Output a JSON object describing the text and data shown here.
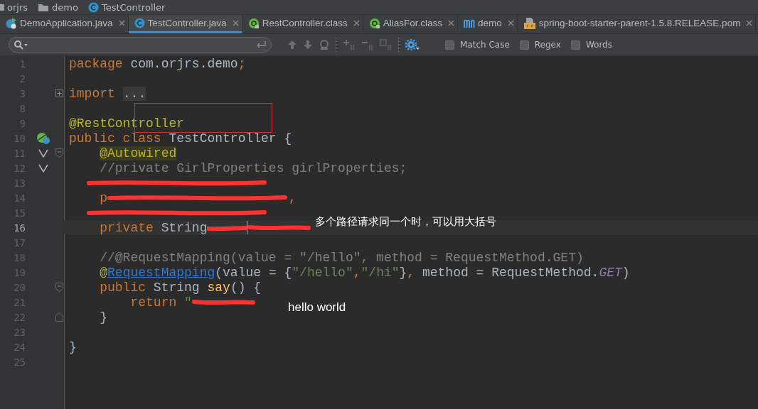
{
  "breadcrumbs": [
    {
      "label": "orjrs",
      "kind": "module"
    },
    {
      "label": "demo",
      "kind": "folder"
    },
    {
      "label": "TestController",
      "kind": "class"
    }
  ],
  "tabs": [
    {
      "label": "DemoApplication.java",
      "kind": "app",
      "selected": false
    },
    {
      "label": "TestController.java",
      "kind": "class",
      "selected": true
    },
    {
      "label": "RestController.class",
      "kind": "annotation",
      "selected": false
    },
    {
      "label": "AliasFor.class",
      "kind": "annotation",
      "selected": false
    },
    {
      "label": "demo",
      "kind": "maven",
      "selected": false
    },
    {
      "label": "spring-boot-starter-parent-1.5.8.RELEASE.pom",
      "kind": "pom",
      "selected": false
    }
  ],
  "search": {
    "options": [
      {
        "label": "Match Case",
        "checked": false
      },
      {
        "label": "Regex",
        "checked": false
      },
      {
        "label": "Words",
        "checked": false
      }
    ]
  },
  "lines": [
    {
      "number": "1",
      "tokens": [
        {
          "kind": "kw",
          "text": "package"
        },
        {
          "kind": "plain",
          "text": " com.orjrs.demo"
        },
        {
          "kind": "kw",
          "text": ";"
        }
      ]
    },
    {
      "number": "2"
    },
    {
      "number": "3",
      "fold": {
        "kind": "collapsed"
      },
      "tokens": [
        {
          "kind": "kw",
          "text": "import"
        },
        {
          "kind": "folded",
          "text": "..."
        }
      ]
    },
    {
      "number": "8"
    },
    {
      "number": "9",
      "tokens": [
        {
          "kind": "ann",
          "text": "@RestController"
        }
      ]
    },
    {
      "number": "10",
      "gutter_icon": {
        "kind": "bean"
      },
      "tokens": [
        {
          "kind": "kw",
          "text": "public class "
        },
        {
          "kind": "plain",
          "text": "TestController {"
        }
      ]
    },
    {
      "number": "11",
      "gutter_icon": {
        "kind": "autowired"
      },
      "fold": {
        "kind": "open"
      },
      "tokens": [
        {
          "kind": "annhl",
          "text": "    @Autowired"
        }
      ]
    },
    {
      "number": "12",
      "gutter_icon": {
        "kind": "autowired"
      },
      "tokens": [
        {
          "kind": "cmt",
          "text": "    //private GirlProperties girlProperties;"
        }
      ]
    },
    {
      "number": "13",
      "tokens": [
        {
          "kind": "longscribble"
        }
      ]
    },
    {
      "number": "14",
      "tokens": [
        {
          "kind": "kw",
          "text": "    p"
        },
        {
          "kind": "longscribble"
        },
        {
          "kind": "kw",
          "text": ","
        }
      ]
    },
    {
      "number": "15",
      "tokens": [
        {
          "kind": "longscribble"
        }
      ]
    },
    {
      "number": "16",
      "current": true,
      "tokens": [
        {
          "kind": "kw",
          "text": "    private "
        },
        {
          "kind": "plain",
          "text": "String"
        },
        {
          "kind": "tinyscribble"
        },
        {
          "kind": "caret"
        },
        {
          "kind": "shortscribble"
        }
      ]
    },
    {
      "number": "17"
    },
    {
      "number": "18",
      "tokens": [
        {
          "kind": "cmt",
          "text": "    //@RequestMapping(value = \"/hello\", method = RequestMethod.GET)"
        }
      ]
    },
    {
      "number": "19",
      "tokens": [
        {
          "kind": "ann",
          "text": "    @"
        },
        {
          "kind": "link",
          "text": "RequestMapping"
        },
        {
          "kind": "plain",
          "text": "(value = {"
        },
        {
          "kind": "str",
          "text": "\"/hello\""
        },
        {
          "kind": "kw",
          "text": ","
        },
        {
          "kind": "str",
          "text": "\"/hi\""
        },
        {
          "kind": "plain",
          "text": "}"
        },
        {
          "kind": "kw",
          "text": ", "
        },
        {
          "kind": "plain",
          "text": "method = RequestMethod."
        },
        {
          "kind": "const",
          "text": "GET"
        },
        {
          "kind": "plain",
          "text": ")"
        }
      ]
    },
    {
      "number": "20",
      "fold": {
        "kind": "open"
      },
      "tokens": [
        {
          "kind": "kw",
          "text": "    public "
        },
        {
          "kind": "plain",
          "text": "String "
        },
        {
          "kind": "fn",
          "text": "say"
        },
        {
          "kind": "plain",
          "text": "() {"
        }
      ]
    },
    {
      "number": "21",
      "tokens": [
        {
          "kind": "kw",
          "text": "        return "
        },
        {
          "kind": "str",
          "text": "\""
        },
        {
          "kind": "shortscribble"
        }
      ]
    },
    {
      "number": "22",
      "fold": {
        "kind": "end"
      },
      "tokens": [
        {
          "kind": "plain",
          "text": "    }"
        }
      ]
    },
    {
      "number": "23"
    },
    {
      "number": "24",
      "tokens": [
        {
          "kind": "plain",
          "text": "}"
        }
      ]
    },
    {
      "number": "25"
    }
  ],
  "annotations": [
    {
      "kind": "note",
      "text": "多个路径请求同一个时，可以用大括号"
    },
    {
      "kind": "label",
      "text": "hello world"
    },
    {
      "kind": "frame"
    }
  ]
}
